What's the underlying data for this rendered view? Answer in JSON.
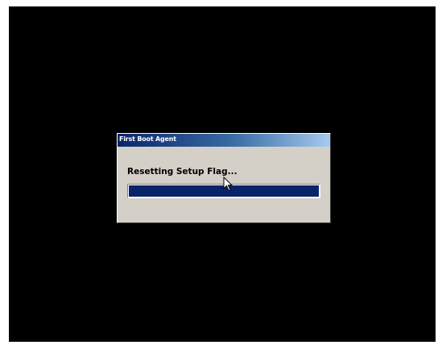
{
  "dialog": {
    "title": "First Boot Agent",
    "status_text": "Resetting Setup Flag...",
    "progress_fraction": 1.0
  },
  "colors": {
    "desktop": "#000000",
    "dialog_face": "#d4d0c8",
    "progress_fill": "#0a246a",
    "titlebar_start": "#0a246a",
    "titlebar_end": "#a6caf0"
  },
  "icons": {
    "cursor": "mouse-pointer-icon"
  }
}
